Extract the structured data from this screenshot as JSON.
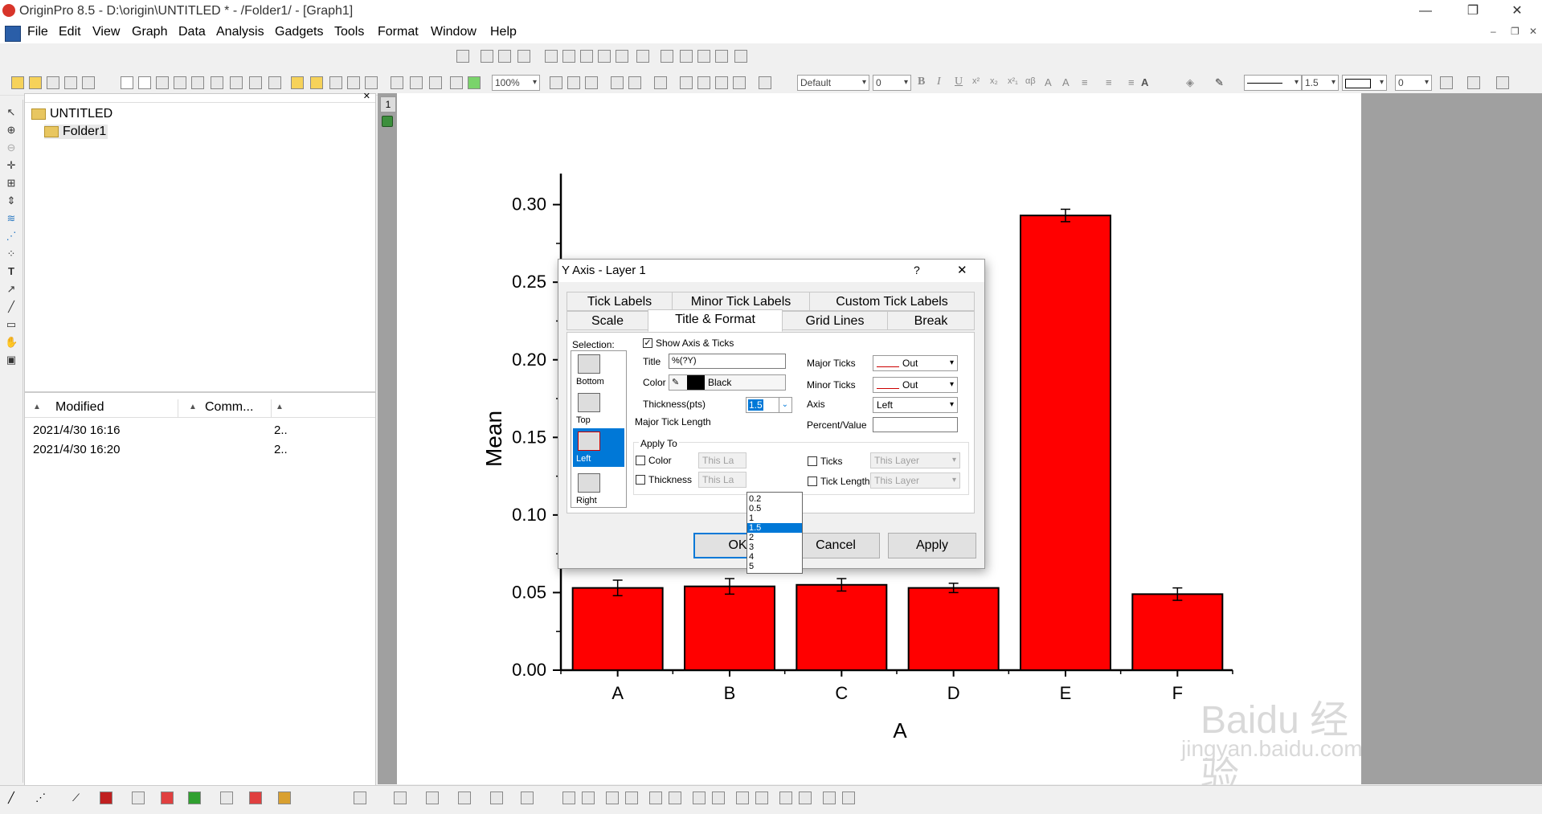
{
  "window": {
    "title": "OriginPro 8.5 - D:\\origin\\UNTITLED * - /Folder1/ - [Graph1]",
    "minimize": "—",
    "restore": "❐",
    "close": "✕"
  },
  "menu": [
    "File",
    "Edit",
    "View",
    "Graph",
    "Data",
    "Analysis",
    "Gadgets",
    "Tools",
    "Format",
    "Window",
    "Help"
  ],
  "toolbar": {
    "zoom": "100%",
    "font": "Default",
    "font_size": "0",
    "bold": "B",
    "italic": "I",
    "underline": "U",
    "line_width": "1.5",
    "fill_value": "0"
  },
  "explorer": {
    "root": "UNTITLED",
    "folder": "Folder1",
    "columns": [
      "Modified",
      "Comm..."
    ],
    "rows": [
      {
        "modified": "2021/4/30 16:16",
        "extra": "2.."
      },
      {
        "modified": "2021/4/30 16:20",
        "extra": "2.."
      }
    ]
  },
  "graph": {
    "layer_badge": "1"
  },
  "chart_data": {
    "type": "bar",
    "categories": [
      "A",
      "B",
      "C",
      "D",
      "E",
      "F"
    ],
    "values": [
      0.053,
      0.054,
      0.055,
      0.053,
      0.293,
      0.049
    ],
    "errors": [
      0.005,
      0.005,
      0.004,
      0.003,
      0.004,
      0.004
    ],
    "xlabel": "A",
    "ylabel": "Mean",
    "ylim": [
      0,
      0.32
    ],
    "yticks": [
      "0.00",
      "0.05",
      "0.10",
      "0.15",
      "0.20",
      "0.25",
      "0.30"
    ],
    "bar_color": "#ff0000",
    "grid": false
  },
  "dialog": {
    "title": "Y Axis - Layer 1",
    "help": "?",
    "close": "✕",
    "tabs_row1": [
      "Tick Labels",
      "Minor Tick Labels",
      "Custom Tick Labels"
    ],
    "tabs_row2": [
      "Scale",
      "Title & Format",
      "Grid Lines",
      "Break"
    ],
    "active_tab": "Title & Format",
    "selection_label": "Selection:",
    "selection_items": [
      "Bottom",
      "Top",
      "Left",
      "Right"
    ],
    "selected_item": "Left",
    "show_axis_label": "Show Axis & Ticks",
    "title_label": "Title",
    "title_value": "%(?Y)",
    "color_label": "Color",
    "color_value": "Black",
    "thickness_label": "Thickness(pts)",
    "thickness_value": "1.5",
    "thickness_options": [
      "0.2",
      "0.5",
      "1",
      "1.5",
      "2",
      "3",
      "4",
      "5"
    ],
    "major_tick_length_label": "Major Tick Length",
    "major_ticks_label": "Major Ticks",
    "major_ticks_value": "Out",
    "minor_ticks_label": "Minor Ticks",
    "minor_ticks_value": "Out",
    "axis_label": "Axis",
    "axis_value": "Left",
    "percent_value_label": "Percent/Value",
    "apply_to_label": "Apply To",
    "apply_color": "Color",
    "apply_thickness": "Thickness",
    "apply_ticks": "Ticks",
    "apply_tick_length": "Tick Length",
    "this_layer_short": "This La",
    "this_layer": "This Layer",
    "ok": "OK",
    "cancel": "Cancel",
    "apply": "Apply"
  },
  "watermark": {
    "line1": "Bai",
    "line1b": "du",
    "line1c": "经验",
    "line2": "jingyan.baidu.com"
  }
}
